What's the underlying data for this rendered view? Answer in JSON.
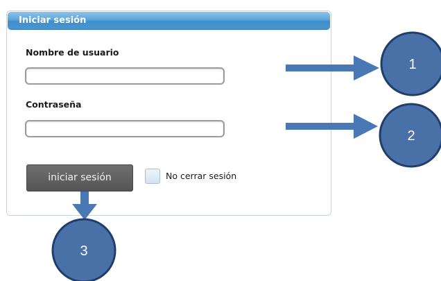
{
  "panel": {
    "title": "Iniciar sesión",
    "username_label": "Nombre de usuario",
    "username_value": "",
    "password_label": "Contraseña",
    "password_value": "",
    "login_button": "iniciar sesión",
    "remember_label": "No cerrar sesión",
    "remember_checked": false
  },
  "annotations": {
    "markers": [
      "1",
      "2",
      "3"
    ],
    "marker_color": "#4a70a8",
    "arrow_color": "#4a78b5"
  }
}
